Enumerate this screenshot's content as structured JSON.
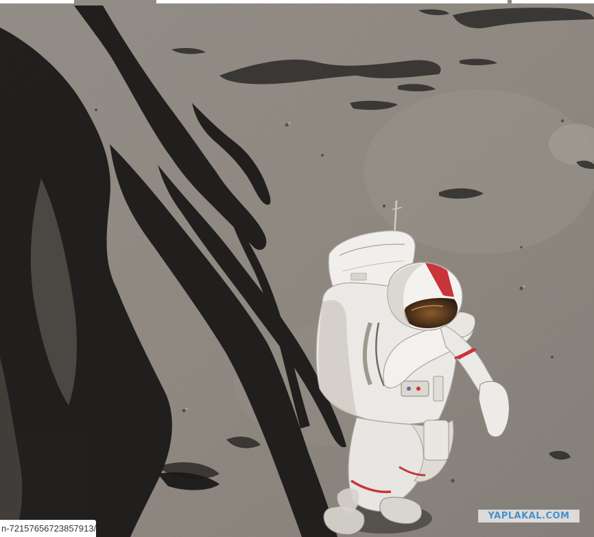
{
  "photo": {
    "alt": "",
    "colors": {
      "regolith": "#8a847c",
      "regolith_light": "#a39d95",
      "shadow": "#1c1a18",
      "suit": "#e9e7e3",
      "stripe": "#c8343a"
    }
  },
  "caption": {
    "url_fragment": "n-72157656723857913/"
  },
  "watermark": {
    "text": "YAPLAKAL.COM",
    "color": "#4a8fc7"
  }
}
